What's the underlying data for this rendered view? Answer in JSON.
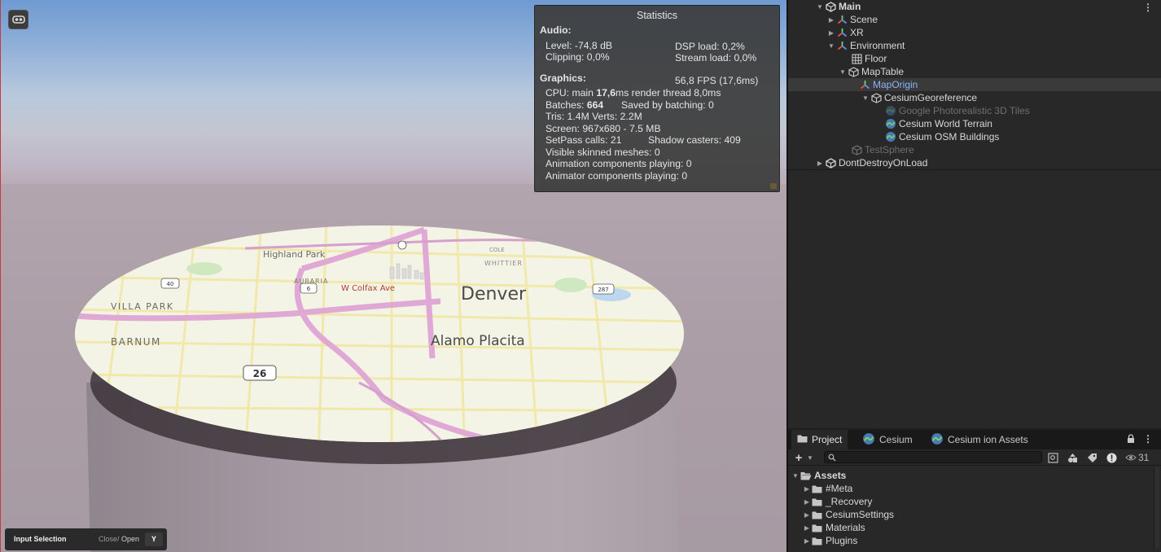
{
  "game": {
    "vr_icon": "vr-headset-icon",
    "map_labels": {
      "denver": "Denver",
      "alamo": "Alamo Placita",
      "highland": "Highland Park",
      "villa_park": "VILLA PARK",
      "barnum": "BARNUM",
      "whittier": "WHITTIER",
      "colfax": "W Colfax Ave",
      "auraria": "AURARIA",
      "cole": "COLE",
      "route_26": "26",
      "route_40": "40",
      "route_287": "287",
      "route_6": "6",
      "lower_fragment": "AL"
    }
  },
  "stats": {
    "title": "Statistics",
    "audio_header": "Audio:",
    "level": "Level: -74,8 dB",
    "clipping": "Clipping: 0,0%",
    "dsp": "DSP load: 0,2%",
    "stream": "Stream load: 0,0%",
    "graphics_header": "Graphics:",
    "fps": "56,8 FPS (17,6ms)",
    "cpu_prefix": "CPU: main ",
    "cpu_main": "17,6",
    "cpu_suffix": "ms  render thread 8,0ms",
    "batches_prefix": "Batches: ",
    "batches_value": "664",
    "saved": "Saved by batching: 0",
    "tris": "Tris: 1.4M  Verts: 2.2M",
    "screen": "Screen: 967x680 - 7.5 MB",
    "setpass": "SetPass calls: 21",
    "shadow": "Shadow casters: 409",
    "skinned": "Visible skinned meshes: 0",
    "animation": "Animation components playing: 0",
    "animator": "Animator components playing: 0"
  },
  "input_bar": {
    "label": "Input Selection",
    "close": "Close",
    "open": "Open",
    "key": "Y"
  },
  "hierarchy": {
    "items": [
      {
        "label": "Main",
        "arrow": "▼",
        "icon": "unity-scene-icon"
      },
      {
        "label": "Scene",
        "arrow": "▶",
        "icon": "prefab-gizmo-icon"
      },
      {
        "label": "XR",
        "arrow": "▶",
        "icon": "prefab-gizmo-icon"
      },
      {
        "label": "Environment",
        "arrow": "▼",
        "icon": "prefab-gizmo-icon"
      },
      {
        "label": "Floor",
        "arrow": "",
        "icon": "grid-icon"
      },
      {
        "label": "MapTable",
        "arrow": "▼",
        "icon": "cube-icon"
      },
      {
        "label": "MapOrigin",
        "arrow": "",
        "icon": "prefab-gizmo-icon"
      },
      {
        "label": "CesiumGeoreference",
        "arrow": "▼",
        "icon": "cube-icon"
      },
      {
        "label": "Google Photorealistic 3D Tiles",
        "arrow": "",
        "icon": "cesium-icon"
      },
      {
        "label": "Cesium World Terrain",
        "arrow": "",
        "icon": "cesium-icon"
      },
      {
        "label": "Cesium OSM Buildings",
        "arrow": "",
        "icon": "cesium-icon"
      },
      {
        "label": "TestSphere",
        "arrow": "",
        "icon": "cube-icon"
      },
      {
        "label": "DontDestroyOnLoad",
        "arrow": "▶",
        "icon": "unity-scene-icon"
      }
    ],
    "menu_icon": "kebab-menu-icon"
  },
  "project": {
    "tabs": [
      {
        "label": "Project",
        "icon": "folder-icon"
      },
      {
        "label": "Cesium",
        "icon": "cesium-icon"
      },
      {
        "label": "Cesium ion Assets",
        "icon": "cesium-icon"
      }
    ],
    "hidden_count": "31",
    "search_placeholder": "",
    "root": "Assets",
    "folders": [
      "#Meta",
      "_Recovery",
      "CesiumSettings",
      "Materials",
      "Plugins"
    ]
  }
}
